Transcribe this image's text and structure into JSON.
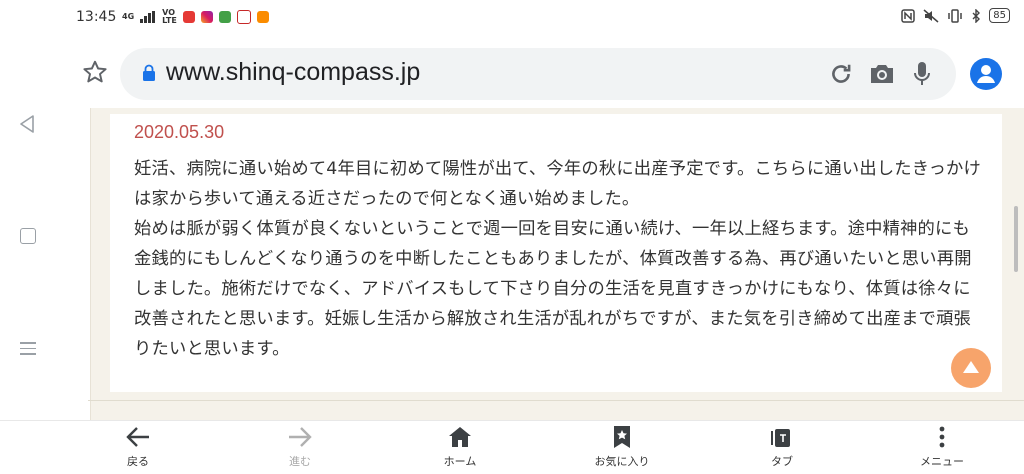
{
  "status_bar": {
    "time": "13:45",
    "network_label": "4G",
    "volte_top": "VO",
    "volte_bottom": "LTE",
    "battery": "85"
  },
  "browser": {
    "url": "www.shinq-compass.jp",
    "accent_color": "#1a73e8"
  },
  "entry": {
    "date": "2020.05.30",
    "text": "妊活、病院に通い始めて4年目に初めて陽性が出て、今年の秋に出産予定です。こちらに通い出したきっかけは家から歩いて通える近さだったので何となく通い始めました。\n始めは脈が弱く体質が良くないということで週一回を目安に通い続け、一年以上経ちます。途中精神的にも金銭的にもしんどくなり通うのを中断したこともありましたが、体質改善する為、再び通いたいと思い再開しました。施術だけでなく、アドバイスもして下さり自分の生活を見直すきっかけにもなり、体質は徐々に改善されたと思います。妊娠し生活から解放され生活が乱れがちですが、また気を引き締めて出産まで頑張りたいと思います。",
    "date_color": "#c0504d"
  },
  "bottom_nav": {
    "back": "戻る",
    "forward": "進む",
    "home": "ホーム",
    "bookmarks": "お気に入り",
    "tabs": "タブ",
    "menu": "メニュー"
  }
}
